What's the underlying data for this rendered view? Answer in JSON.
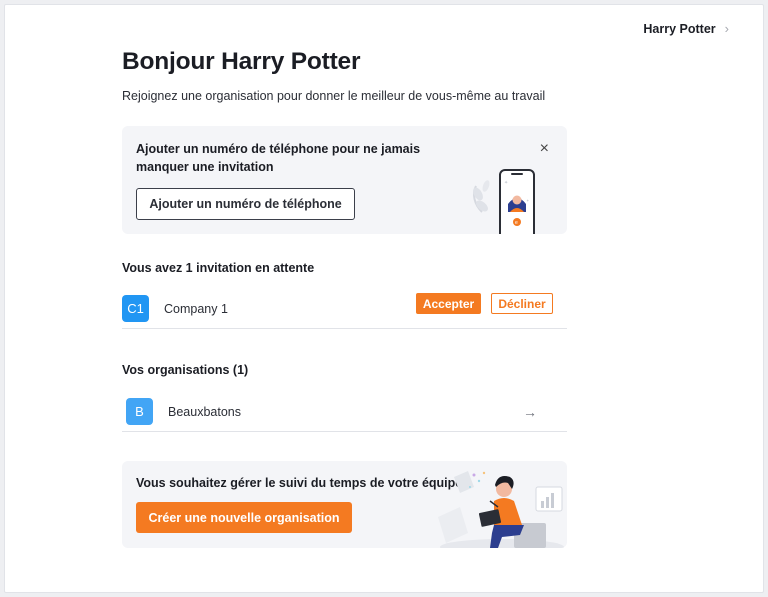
{
  "header": {
    "user_name": "Harry Potter",
    "chevron_icon": "chevron-right-icon"
  },
  "page": {
    "title": "Bonjour Harry Potter",
    "subtitle": "Rejoignez une organisation pour donner le meilleur de vous-même au travail"
  },
  "phone_card": {
    "message": "Ajouter un numéro de téléphone pour ne jamais manquer une invitation",
    "button_label": "Ajouter un numéro de téléphone",
    "close_icon": "×"
  },
  "invitations": {
    "title": "Vous avez 1 invitation en attente",
    "items": [
      {
        "avatar": "C1",
        "name": "Company 1",
        "accept_label": "Accepter",
        "decline_label": "Décliner",
        "avatar_color": "#2196f3"
      }
    ]
  },
  "organisations": {
    "title": "Vos organisations (1)",
    "items": [
      {
        "avatar": "B",
        "name": "Beauxbatons",
        "arrow": "→",
        "avatar_color": "#42a5f5"
      }
    ]
  },
  "team_card": {
    "message": "Vous souhaitez gérer le suivi du temps de votre équipe?",
    "button_label": "Créer une nouvelle organisation"
  },
  "colors": {
    "accent": "#f47a21",
    "card_bg": "#f4f5f8"
  }
}
